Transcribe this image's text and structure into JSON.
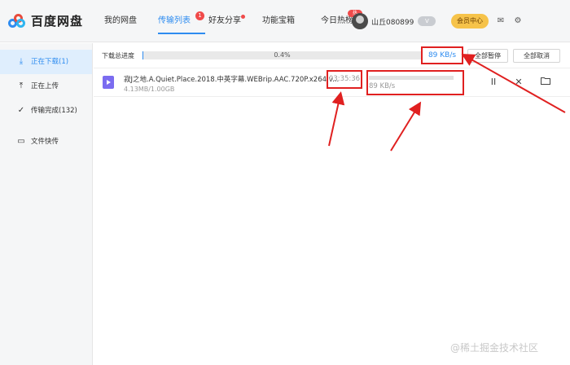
{
  "app": {
    "name": "百度网盘"
  },
  "nav": {
    "items": [
      "我的网盘",
      "传输列表",
      "好友分享",
      "功能宝箱",
      "今日热榜"
    ],
    "transfer_badge": "1",
    "hot_tag": "热"
  },
  "user": {
    "name": "山丘080899",
    "vip": "V"
  },
  "member_center": "会员中心",
  "sidebar": {
    "items": [
      {
        "label": "正在下载(1)",
        "icon": "download-icon"
      },
      {
        "label": "正在上传",
        "icon": "upload-icon"
      },
      {
        "label": "传输完成(132)",
        "icon": "check-circle-icon"
      },
      {
        "label": "文件快传",
        "icon": "monitor-icon"
      }
    ]
  },
  "download": {
    "progress_label": "下载总进度",
    "progress_percent": "0.4%",
    "progress_value": 0.004,
    "total_speed": "89 KB/s",
    "pause_all": "全部暂停",
    "cancel_all": "全部取消"
  },
  "task": {
    "file_name": "寂J之地.A.Quiet.Place.2018.中英字幕.WEBrip.AAC.720P.x264.v...",
    "size": "4.13MB/1.00GB",
    "remaining_time": "03:35:36",
    "speed": "89 KB/s",
    "pause_symbol": "II",
    "close_symbol": "✕"
  },
  "colors": {
    "accent": "#2e8cf0",
    "annotation": "#e02020",
    "badge": "#f04a4a",
    "member": "#f6c34a"
  },
  "watermark": "@稀土掘金技术社区"
}
